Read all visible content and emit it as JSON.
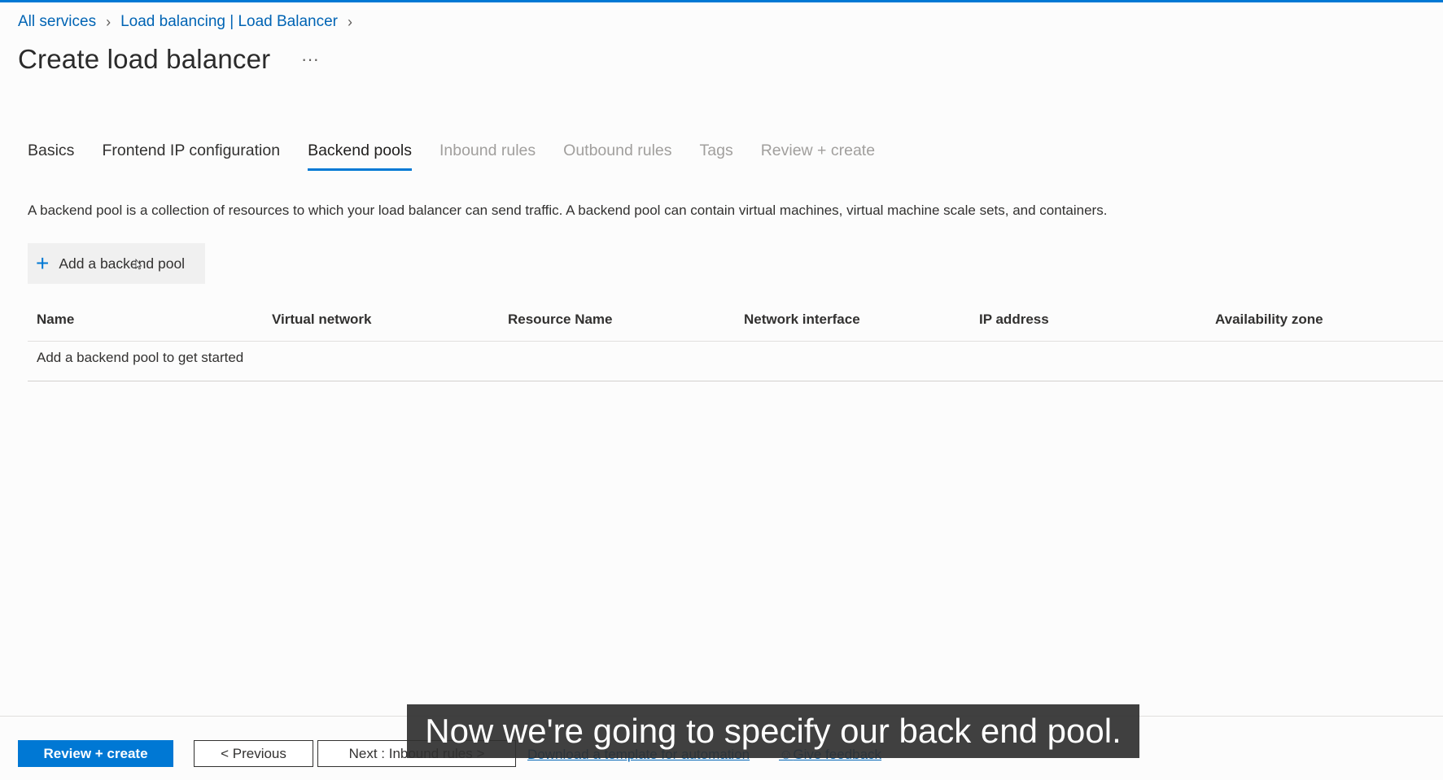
{
  "breadcrumb": {
    "items": [
      "All services",
      "Load balancing | Load Balancer"
    ]
  },
  "page": {
    "title": "Create load balancer",
    "more": "···"
  },
  "tabs": [
    {
      "label": "Basics",
      "state": "enabled"
    },
    {
      "label": "Frontend IP configuration",
      "state": "enabled"
    },
    {
      "label": "Backend pools",
      "state": "active"
    },
    {
      "label": "Inbound rules",
      "state": "disabled"
    },
    {
      "label": "Outbound rules",
      "state": "disabled"
    },
    {
      "label": "Tags",
      "state": "disabled"
    },
    {
      "label": "Review + create",
      "state": "disabled"
    }
  ],
  "description": "A backend pool is a collection of resources to which your load balancer can send traffic. A backend pool can contain virtual machines, virtual machine scale sets, and containers.",
  "add_button": {
    "label": "Add a backend pool",
    "icon": "plus-icon"
  },
  "table": {
    "columns": [
      "Name",
      "Virtual network",
      "Resource Name",
      "Network interface",
      "IP address",
      "Availability zone"
    ],
    "empty_text": "Add a backend pool to get started"
  },
  "footer": {
    "review_label": "Review + create",
    "previous_label": "< Previous",
    "next_label": "Next : Inbound rules >",
    "download_link": "Download a template for automation",
    "feedback_link": "Give feedback",
    "feedback_icon": "feedback-person-icon"
  },
  "caption": "Now we're going to specify our back end pool.",
  "colors": {
    "accent": "#0078d4",
    "link": "#0064b4"
  }
}
